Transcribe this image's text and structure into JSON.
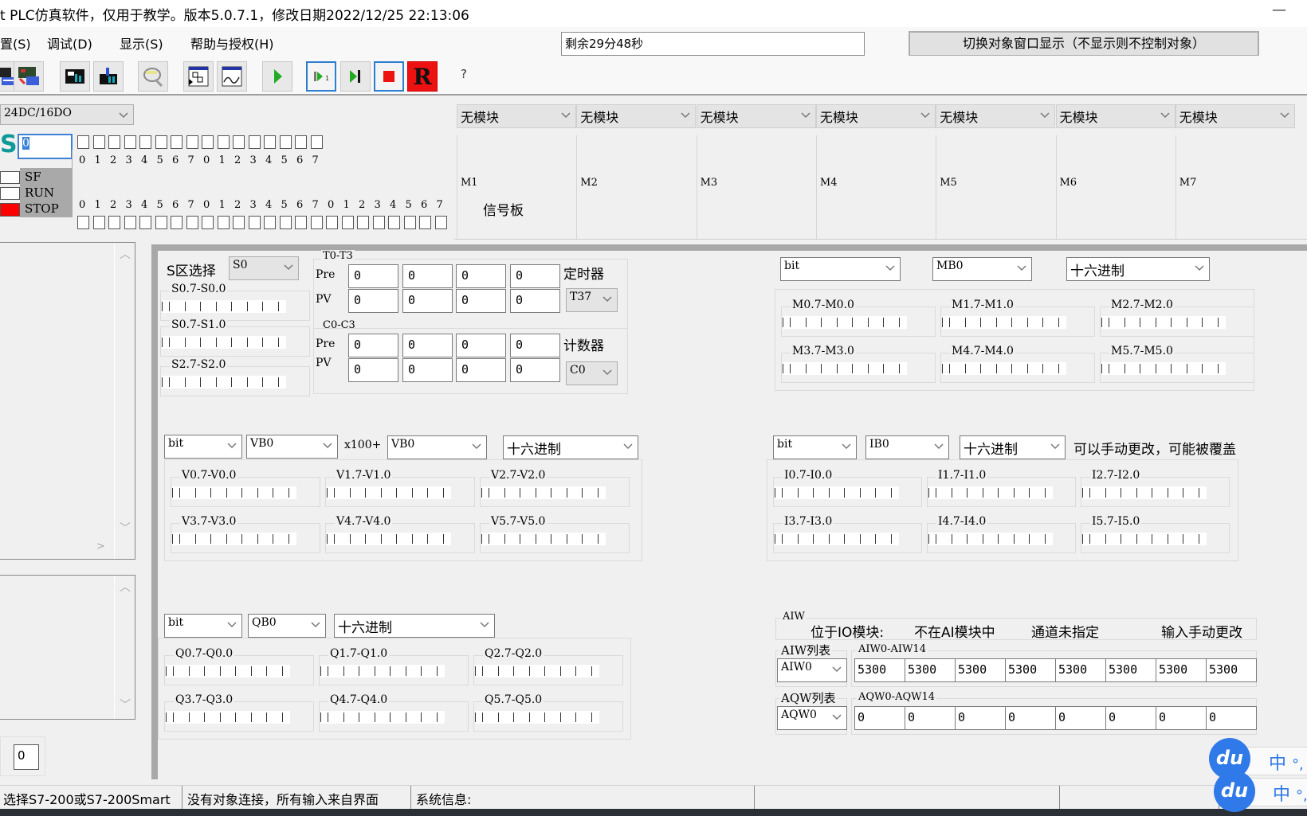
{
  "window": {
    "title": "t PLC仿真软件，仅用于教学。版本5.0.7.1，修改日期2022/12/25 22:13:06",
    "minimize_label": "—"
  },
  "menu": {
    "items": [
      "置(S)",
      "调试(D)",
      "显示(S)",
      "帮助与授权(H)"
    ]
  },
  "timer": {
    "value": "剩余29分48秒"
  },
  "switch_button": {
    "label": "切换对象窗口显示（不显示则不控制对象）"
  },
  "toolbar": {
    "buttons": [
      {
        "icon": "plc-blue-icon"
      },
      {
        "icon": "plc-transfer-icon"
      },
      {
        "icon": "plc-upload-icon"
      },
      {
        "icon": "plc-download-icon"
      },
      {
        "icon": "monitor-icon"
      },
      {
        "icon": "diagram-icon"
      },
      {
        "icon": "trend-icon"
      },
      {
        "icon": "run-icon"
      },
      {
        "icon": "step-icon"
      },
      {
        "icon": "step-end-icon"
      },
      {
        "icon": "stop-icon"
      },
      {
        "icon": "reset-icon"
      }
    ],
    "help_label": "?",
    "reset_letter": "R"
  },
  "cpu": {
    "model_select": "24DC/16DO",
    "logo_letter": "S",
    "address_value": "0",
    "status_leds": [
      {
        "label": "SF",
        "color": "#ffffff"
      },
      {
        "label": "RUN",
        "color": "#ffffff"
      },
      {
        "label": "STOP",
        "color": "#ff0000"
      }
    ],
    "output_digits": [
      "0",
      "1",
      "2",
      "3",
      "4",
      "5",
      "6",
      "7",
      "0",
      "1",
      "2",
      "3",
      "4",
      "5",
      "6",
      "7"
    ],
    "input_digits": [
      "0",
      "1",
      "2",
      "3",
      "4",
      "5",
      "6",
      "7",
      "0",
      "1",
      "2",
      "3",
      "4",
      "5",
      "6",
      "7",
      "0",
      "1",
      "2",
      "3",
      "4",
      "5",
      "6",
      "7"
    ]
  },
  "modules": {
    "slots": [
      {
        "select": "无模块",
        "label": "M1",
        "sublabel": "信号板"
      },
      {
        "select": "无模块",
        "label": "M2",
        "sublabel": ""
      },
      {
        "select": "无模块",
        "label": "M3",
        "sublabel": ""
      },
      {
        "select": "无模块",
        "label": "M4",
        "sublabel": ""
      },
      {
        "select": "无模块",
        "label": "M5",
        "sublabel": ""
      },
      {
        "select": "无模块",
        "label": "M6",
        "sublabel": ""
      },
      {
        "select": "无模块",
        "label": "M7",
        "sublabel": ""
      }
    ]
  },
  "left_panel": {
    "bottom_value": "0"
  },
  "s_area": {
    "label": "S区选择",
    "select": "S0",
    "groups": [
      "S0.7-S0.0",
      "S0.7-S1.0",
      "S2.7-S2.0"
    ]
  },
  "timers": {
    "group_label": "T0-T3",
    "pre_label": "Pre",
    "pv_label": "PV",
    "pre_values": [
      "0",
      "0",
      "0",
      "0"
    ],
    "pv_values": [
      "0",
      "0",
      "0",
      "0"
    ],
    "type_label": "定时器",
    "select": "T37"
  },
  "counters": {
    "group_label": "C0-C3",
    "pre_label": "Pre",
    "pv_label": "PV",
    "pre_values": [
      "0",
      "0",
      "0",
      "0"
    ],
    "pv_values": [
      "0",
      "0",
      "0",
      "0"
    ],
    "type_label": "计数器",
    "select": "C0"
  },
  "m_area": {
    "type_select": "bit",
    "addr_select": "MB0",
    "format_select": "十六进制",
    "groups": [
      "M0.7-M0.0",
      "M1.7-M1.0",
      "M2.7-M2.0",
      "M3.7-M3.0",
      "M4.7-M4.0",
      "M5.7-M5.0"
    ]
  },
  "v_area": {
    "type_select": "bit",
    "addr_select": "VB0",
    "multiplier_label": "x100+",
    "offset_select": "VB0",
    "format_select": "十六进制",
    "groups": [
      "V0.7-V0.0",
      "V1.7-V1.0",
      "V2.7-V2.0",
      "V3.7-V3.0",
      "V4.7-V4.0",
      "V5.7-V5.0"
    ]
  },
  "i_area": {
    "type_select": "bit",
    "addr_select": "IB0",
    "format_select": "十六进制",
    "note": "可以手动更改，可能被覆盖",
    "groups": [
      "I0.7-I0.0",
      "I1.7-I1.0",
      "I2.7-I2.0",
      "I3.7-I3.0",
      "I4.7-I4.0",
      "I5.7-I5.0"
    ]
  },
  "q_area": {
    "type_select": "bit",
    "addr_select": "QB0",
    "format_select": "十六进制",
    "groups": [
      "Q0.7-Q0.0",
      "Q1.7-Q1.0",
      "Q2.7-Q2.0",
      "Q3.7-Q3.0",
      "Q4.7-Q4.0",
      "Q5.7-Q5.0"
    ]
  },
  "analog": {
    "aiw_title": "AIW",
    "module_label": "位于IO模块:",
    "module_value": "不在AI模块中",
    "channel_value": "通道未指定",
    "manual_label": "输入手动更改",
    "aiw_list_label": "AIW列表",
    "aiw_range_label": "AIW0-AIW14",
    "aiw_select": "AIW0",
    "aiw_values": [
      "5300",
      "5300",
      "5300",
      "5300",
      "5300",
      "5300",
      "5300",
      "5300"
    ],
    "aqw_list_label": "AQW列表",
    "aqw_range_label": "AQW0-AQW14",
    "aqw_select": "AQW0",
    "aqw_values": [
      "0",
      "0",
      "0",
      "0",
      "0",
      "0",
      "0",
      "0"
    ]
  },
  "statusbar": {
    "items": [
      "选择S7-200或S7-200Smart",
      "没有对象连接，所有输入来自界面",
      "系统信息:",
      "",
      "",
      ""
    ]
  },
  "ime": {
    "logo": "du",
    "mode": "中",
    "punct": "°,"
  }
}
